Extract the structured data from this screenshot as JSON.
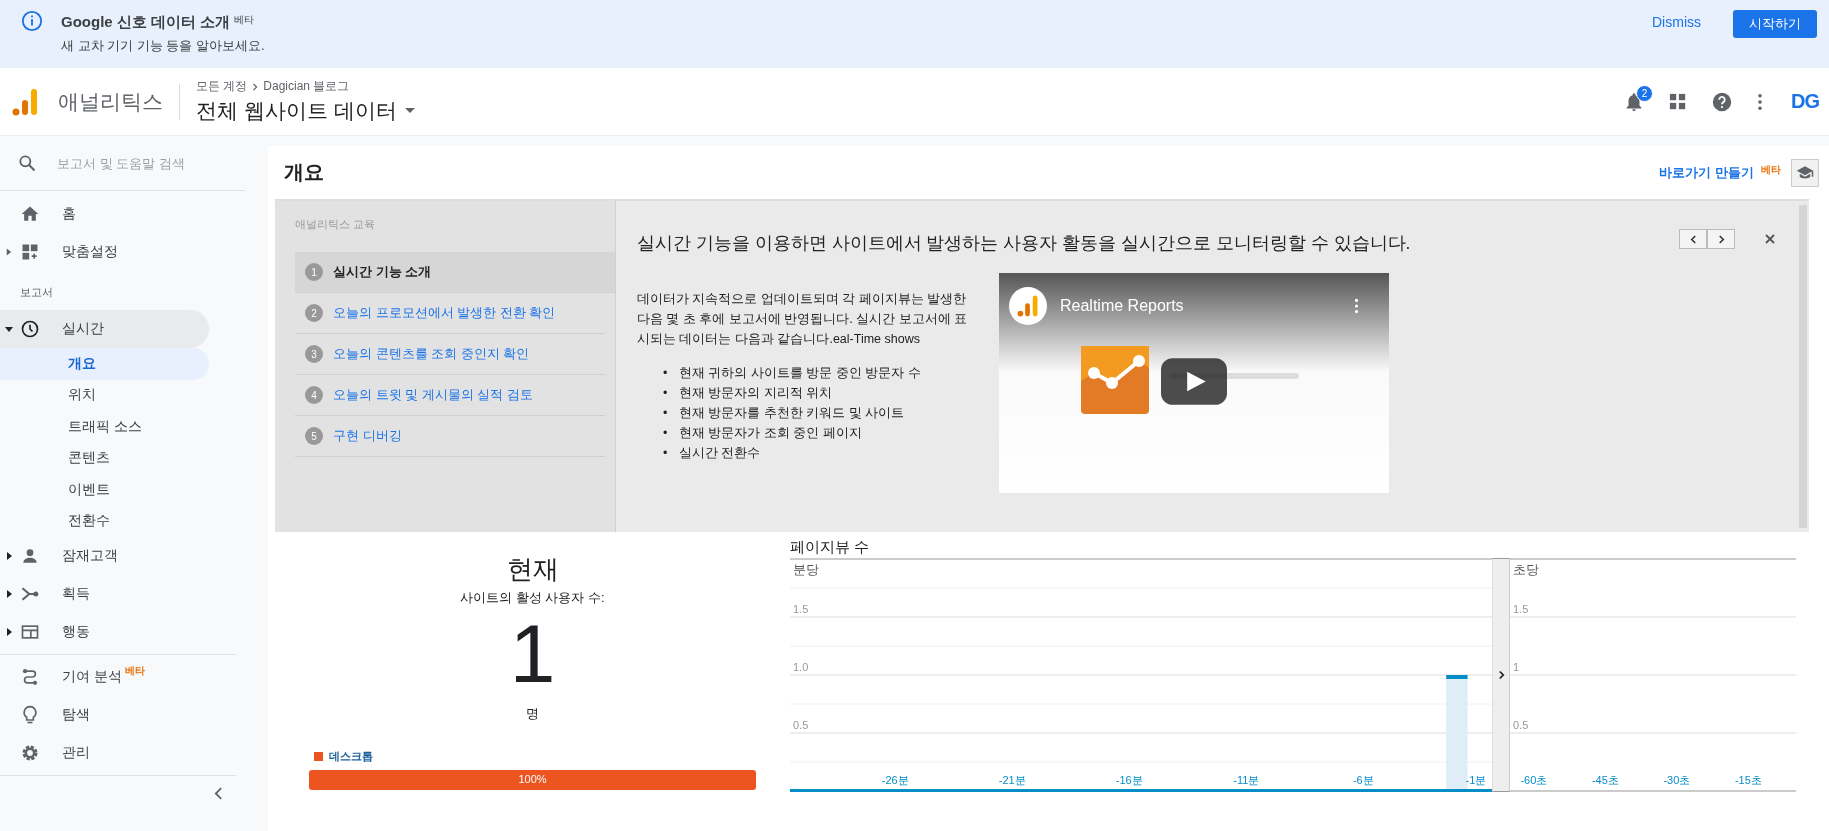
{
  "banner": {
    "title": "Google 신호 데이터 소개",
    "badge": "베타",
    "subtitle": "새 교차 기기 기능 등을 알아보세요.",
    "dismiss": "Dismiss",
    "start": "시작하기"
  },
  "header": {
    "product": "애널리틱스",
    "breadcrumb": [
      "모든 계정",
      "Dagician 블로그"
    ],
    "view": "전체 웹사이트 데이터",
    "notifications": "2",
    "avatar": "DG"
  },
  "sidebar": {
    "search_placeholder": "보고서 및 도움말 검색",
    "top": [
      {
        "kind": "link",
        "label": "홈"
      },
      {
        "kind": "group",
        "label": "맞춤설정",
        "expanded": false
      }
    ],
    "section_title": "보고서",
    "reports": [
      {
        "label": "실시간",
        "expanded": true,
        "active": true,
        "children": [
          {
            "label": "개요",
            "selected": true
          },
          {
            "label": "위치",
            "selected": false
          },
          {
            "label": "트래픽 소스",
            "selected": false
          },
          {
            "label": "콘텐츠",
            "selected": false
          },
          {
            "label": "이벤트",
            "selected": false
          },
          {
            "label": "전환수",
            "selected": false
          }
        ]
      },
      {
        "label": "잠재고객",
        "expanded": false,
        "active": false
      },
      {
        "label": "획득",
        "expanded": false,
        "active": false
      },
      {
        "label": "행동",
        "expanded": false,
        "active": false
      }
    ],
    "bottom": [
      {
        "label": "기여 분석",
        "badge": "베타"
      },
      {
        "label": "탐색"
      },
      {
        "label": "관리"
      }
    ]
  },
  "page": {
    "title": "개요",
    "shortcut": "바로가기 만들기",
    "shortcut_badge": "베타"
  },
  "tutorial": {
    "label": "애널리틱스 교육",
    "steps": [
      {
        "number": "1",
        "title": "실시간 기능 소개",
        "selected": true
      },
      {
        "number": "2",
        "title": "오늘의 프로모션에서 발생한 전환 확인",
        "selected": false
      },
      {
        "number": "3",
        "title": "오늘의 콘텐츠를 조회 중인지 확인",
        "selected": false
      },
      {
        "number": "4",
        "title": "오늘의 트윗 및 게시물의 실적 검토",
        "selected": false
      },
      {
        "number": "5",
        "title": "구현 디버깅",
        "selected": false
      }
    ],
    "heading": "실시간 기능을 이용하면 사이트에서 발생하는 사용자 활동을 실시간으로 모니터링할 수 있습니다.",
    "body": "데이터가 지속적으로 업데이트되며 각 페이지뷰는 발생한 다음 몇 초 후에 보고서에 반영됩니다. 실시간 보고서에 표시되는 데이터는 다음과 같습니다.eal-Time shows",
    "bullet_marker": "•",
    "bullets": [
      "현재 귀하의 사이트를 방문 중인 방문자 수",
      "현재 방문자의 지리적 위치",
      "현재 방문자를 추천한 키워드 및 사이트",
      "현재 방문자가 조회 중인 페이지",
      "실시간 전환수"
    ],
    "video": {
      "title": "Realtime Reports"
    }
  },
  "current": {
    "heading": "현재",
    "subtitle": "사이트의 활성 사용자 수:",
    "count": "1",
    "unit": "명",
    "devices": [
      {
        "label": "데스크톱",
        "color": "#ec5520",
        "level": 1,
        "reading": "100%"
      }
    ]
  },
  "pageviews": {
    "title": "페이지뷰 수",
    "per_minute": {
      "label": "분당",
      "chart_data": {
        "type": "bar",
        "x": [
          -2
        ],
        "values": [
          1
        ],
        "xlim": [
          -30.5,
          -0.5
        ],
        "ylim": [
          0,
          2
        ],
        "grid": true,
        "yticks": [
          0.5,
          {
            "value": 1,
            "label": "1.0"
          },
          1.5
        ],
        "xticks": [
          {
            "value": -26,
            "label": "-26분"
          },
          {
            "value": -21,
            "label": "-21분"
          },
          {
            "value": -16,
            "label": "-16분"
          },
          {
            "value": -11,
            "label": "-11분"
          },
          {
            "value": -6,
            "label": "-6분"
          },
          {
            "value": -1,
            "label": "-1분"
          }
        ]
      }
    },
    "per_second": {
      "label": "초당",
      "chart_data": {
        "type": "bar",
        "xlim": [
          -65,
          -5
        ],
        "ylim": [
          0,
          2
        ],
        "grid": true,
        "yticks": [
          0.5,
          1,
          1.5
        ],
        "xticks": [
          {
            "value": -60,
            "label": "-60초"
          },
          {
            "value": -45,
            "label": "-45초"
          },
          {
            "value": -30,
            "label": "-30초"
          },
          {
            "value": -15,
            "label": "-15초"
          }
        ]
      }
    }
  }
}
